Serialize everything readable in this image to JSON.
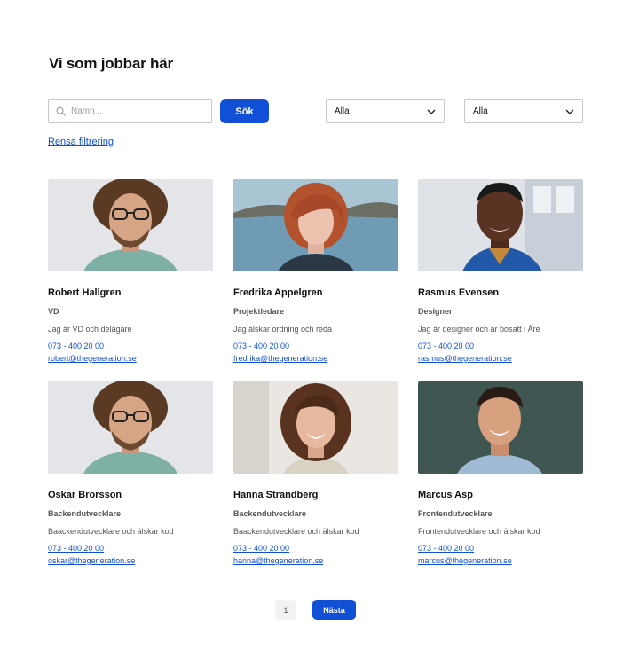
{
  "page": {
    "title": "Vi som jobbar här"
  },
  "search": {
    "placeholder": "Namn...",
    "button_label": "Sök"
  },
  "filters": [
    {
      "selected": "Alla"
    },
    {
      "selected": "Alla"
    }
  ],
  "clear_filter_label": "Rensa filtrering",
  "people": [
    {
      "name": "Robert Hallgren",
      "role": "VD",
      "description": "Jag är VD och delägare",
      "phone": "073 - 400 20 00",
      "email": "robert@thegeneration.se"
    },
    {
      "name": "Fredrika Appelgren",
      "role": "Projektledare",
      "description": "Jag älskar ordning och reda",
      "phone": "073 - 400 20 00",
      "email": "fredrika@thegeneration.se"
    },
    {
      "name": "Rasmus Evensen",
      "role": "Designer",
      "description": "Jag är designer och är bosatt i Åre",
      "phone": "073 - 400 20 00",
      "email": "rasmus@thegeneration.se"
    },
    {
      "name": "Oskar Brorsson",
      "role": "Backendutvecklare",
      "description": "Baackendutvecklare och älskar kod",
      "phone": "073 - 400 20 00",
      "email": "oskar@thegeneration.se"
    },
    {
      "name": "Hanna Strandberg",
      "role": "Backendutvecklare",
      "description": "Baackendutvecklare och älskar kod",
      "phone": "073 - 400 20 00",
      "email": "hanna@thegeneration.se"
    },
    {
      "name": "Marcus Asp",
      "role": "Frontendutvecklare",
      "description": "Frontendutvecklare och älskar kod",
      "phone": "073 - 400 20 00",
      "email": "marcus@thegeneration.se"
    }
  ],
  "pagination": {
    "current_page": "1",
    "next_label": "Nästa"
  },
  "colors": {
    "accent": "#1150d6",
    "text": "#111111",
    "muted": "#555555"
  }
}
